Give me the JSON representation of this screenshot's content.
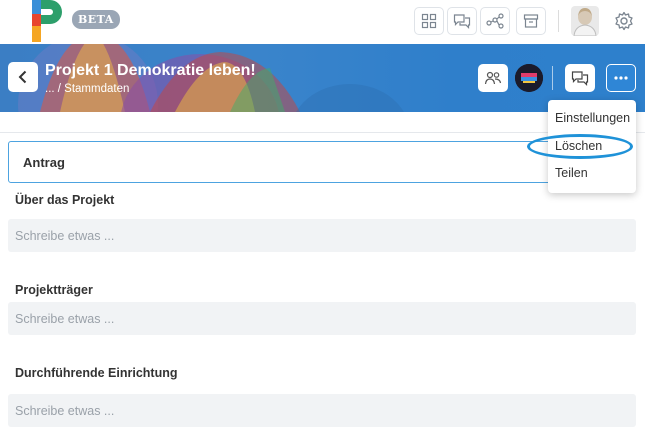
{
  "topbar": {
    "beta_label": "BETA",
    "buttons": [
      {
        "name": "dashboard-icon"
      },
      {
        "name": "chat-icon"
      },
      {
        "name": "network-icon"
      },
      {
        "name": "archive-icon"
      }
    ],
    "avatar": "user-avatar",
    "settings": "gear-icon"
  },
  "banner": {
    "title": "Projekt 1 Demokratie leben!",
    "breadcrumb": "... / Stammdaten"
  },
  "menu": {
    "items": [
      "Einstellungen",
      "Löschen",
      "Teilen"
    ],
    "highlighted": "Löschen"
  },
  "content": {
    "section_title": "Antrag",
    "fields": [
      {
        "label": "Über das Projekt",
        "placeholder": "Schreibe etwas ..."
      },
      {
        "label": "Projektträger",
        "placeholder": "Schreibe etwas ..."
      },
      {
        "label": "Durchführende Einrichtung",
        "placeholder": "Schreibe etwas ..."
      }
    ]
  },
  "colors": {
    "accent": "#2f86d6",
    "highlight": "#1f92d8",
    "banner": "#3a84cb",
    "field_bg": "#f1f3f5"
  }
}
